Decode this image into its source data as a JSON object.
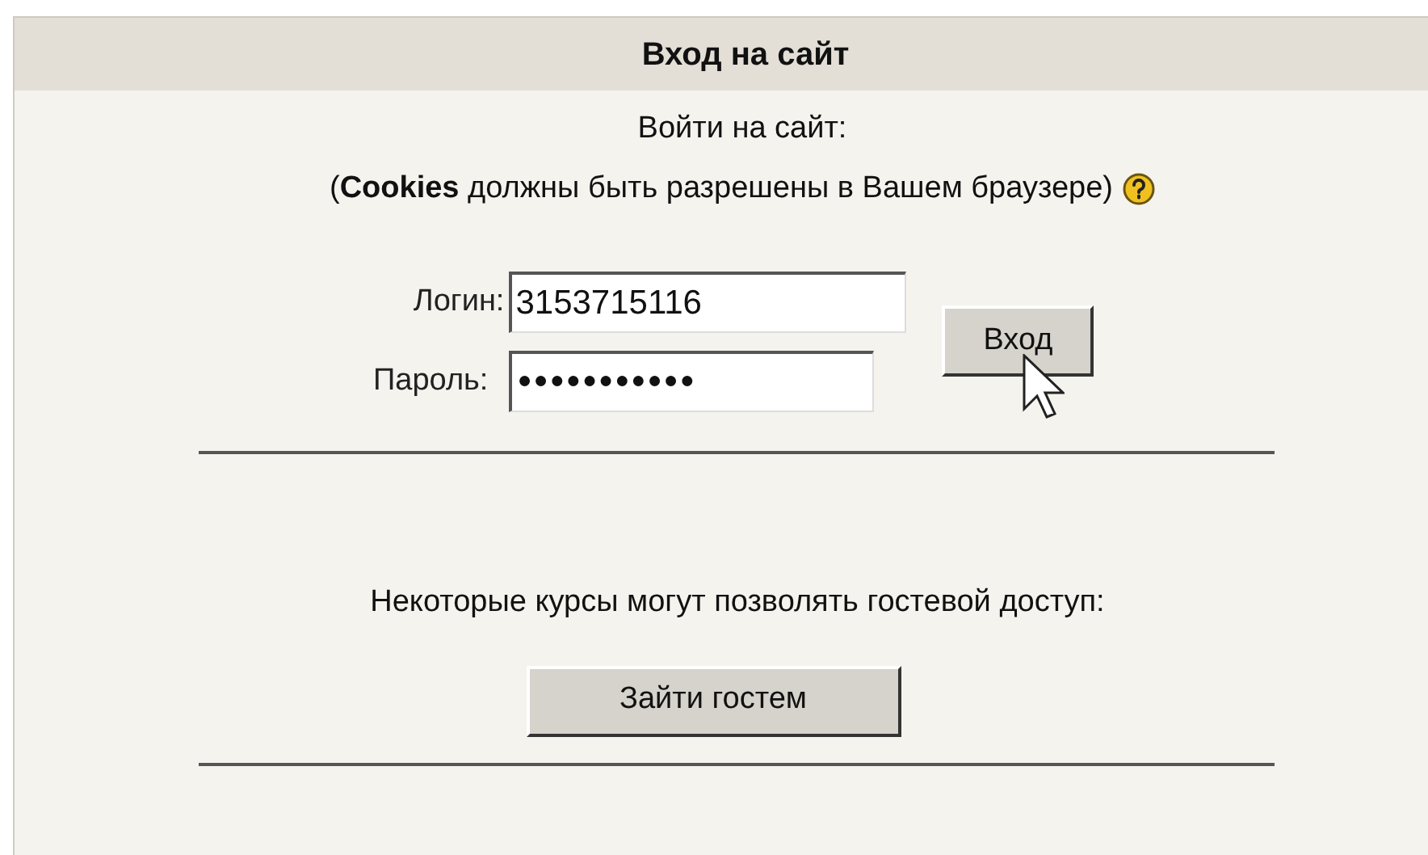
{
  "panel": {
    "title": "Вход на сайт"
  },
  "intro": "Войти на сайт:",
  "cookies_note": "(**Cookies** должны быть разрешены в Вашем браузере)",
  "login": {
    "label": "Логин:",
    "value": "3153715116"
  },
  "password": {
    "label": "Пароль:",
    "value": "●●●●●●●●●●●"
  },
  "login_button": "Вход",
  "guest_note": "Некоторые курсы могут позволять гостевой доступ:",
  "guest_button": "Зайти гостем"
}
